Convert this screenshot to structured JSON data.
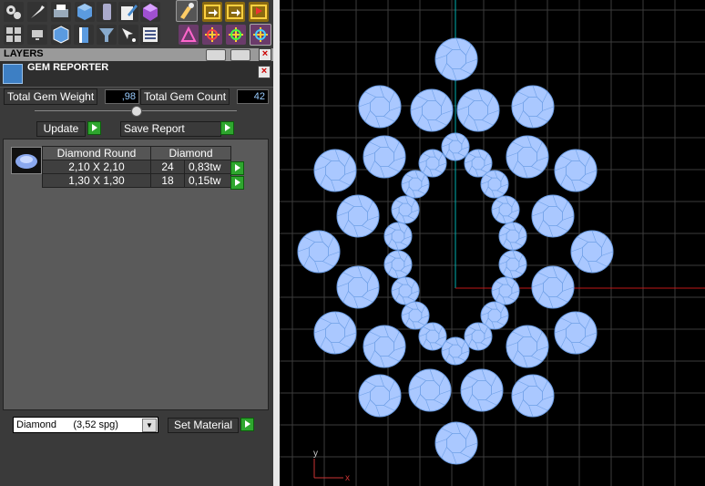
{
  "toolbar": {
    "row1_icons": [
      "gears-icon",
      "wrench-icon",
      "printer-icon",
      "cube-icon",
      "phone-icon",
      "pencil-paper-icon",
      "gem-box-icon",
      "brush-tool-icon",
      "layer-arrow-icon",
      "layer-arrow2-icon",
      "layer-flag-icon"
    ],
    "row2_icons": [
      "grid-icon",
      "monitor-icon",
      "wire-cube-icon",
      "book-icon",
      "funnel-icon",
      "sparkle-cursor-icon",
      "list-icon",
      "mesh-tool-icon",
      "gizmo-icon",
      "gizmo2-icon",
      "gizmo3-icon"
    ]
  },
  "layers_panel": {
    "title": "LAYERS"
  },
  "gem_reporter": {
    "title": "GEM REPORTER",
    "total_weight_label": "Total Gem Weight",
    "total_weight_value": ",98",
    "total_count_label": "Total Gem Count",
    "total_count_value": "42",
    "update_label": "Update",
    "save_report_label": "Save Report",
    "table": {
      "header_cut": "Diamond Round",
      "header_material": "Diamond",
      "rows": [
        {
          "size": "2,10 X 2,10",
          "count": "24",
          "weight": "0,83tw"
        },
        {
          "size": "1,30 X 1,30",
          "count": "18",
          "weight": "0,15tw"
        }
      ]
    },
    "material_value": "Diamond      (3,52 spg)",
    "set_material_label": "Set Material"
  },
  "viewport": {
    "axis_label_y": "y",
    "axis_label_x": "x",
    "colors": {
      "gem_fill": "#aac8ff",
      "gem_stroke": "#6e9fe6",
      "grid": "#3c3c3c",
      "y_axis": "#00b0b0",
      "x_axis": "#c01818"
    }
  }
}
